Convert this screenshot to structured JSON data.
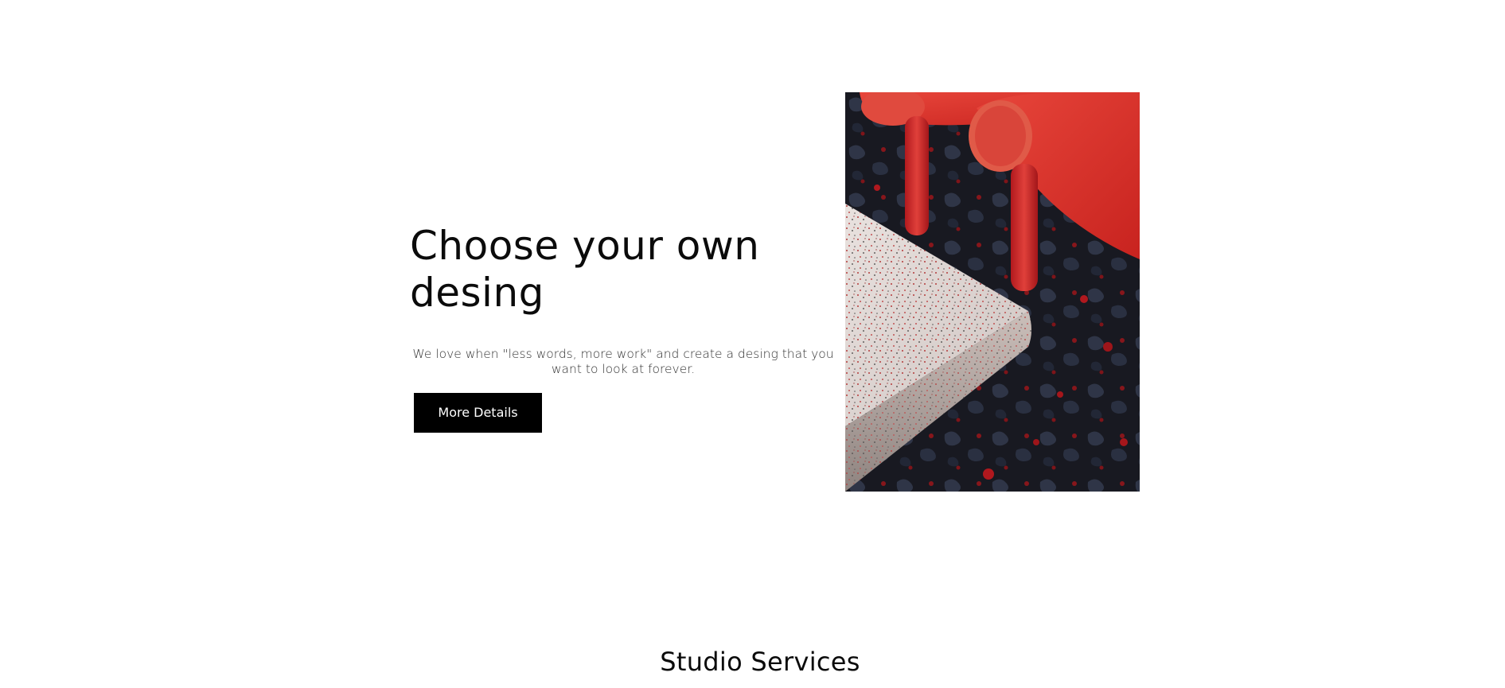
{
  "hero": {
    "title_line1": "Choose your own",
    "title_line2": "desing",
    "description": "We love when \"less words, more work\" and create a desing that you want to look at forever.",
    "button_label": "More Details"
  },
  "services": {
    "heading": "Studio Services"
  },
  "colors": {
    "button_bg": "#000000",
    "button_text": "#ffffff",
    "chair_red": "#d9352b",
    "floor_dark": "#1c1d26"
  }
}
